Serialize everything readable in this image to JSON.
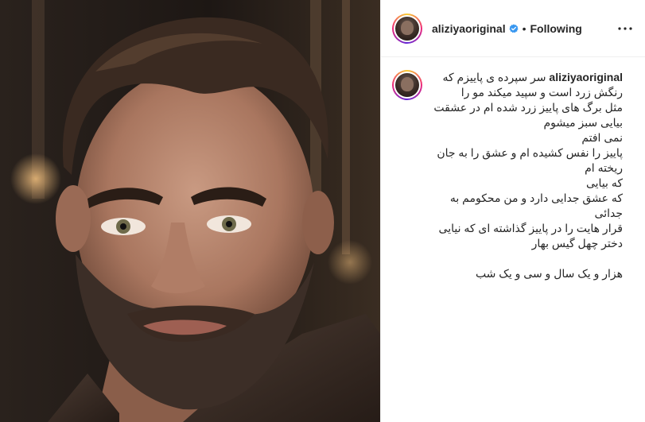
{
  "post": {
    "username": "aliziyaoriginal",
    "follow_status": "Following",
    "separator": "•",
    "more_icon": "more-horizontal-icon",
    "verified_icon": "verified-badge-icon",
    "colors": {
      "verified": "#3897f0",
      "border": "#efefef",
      "text": "#262626"
    }
  },
  "caption": {
    "username": "aliziyaoriginal",
    "first_line": "سر سپرده ی پاییزم که",
    "lines": [
      "رنگش زرد است و سپید میکند مو را",
      "مثل برگ های پاییز زرد شده ام در عشقت",
      "بیایی سبز میشوم",
      "نمی افتم",
      "پاییز را نفس کشیده ام و عشق را به جان",
      "ریخته ام",
      "که بیایی",
      "که عشق جدایی دارد و من محکومم به",
      "جدائی",
      "قرار هایت را در پاییز گذاشته ای که نیایی",
      "دختر چهل گیس بهار"
    ],
    "closing": "هزار و یک سال و سی و یک شب"
  }
}
